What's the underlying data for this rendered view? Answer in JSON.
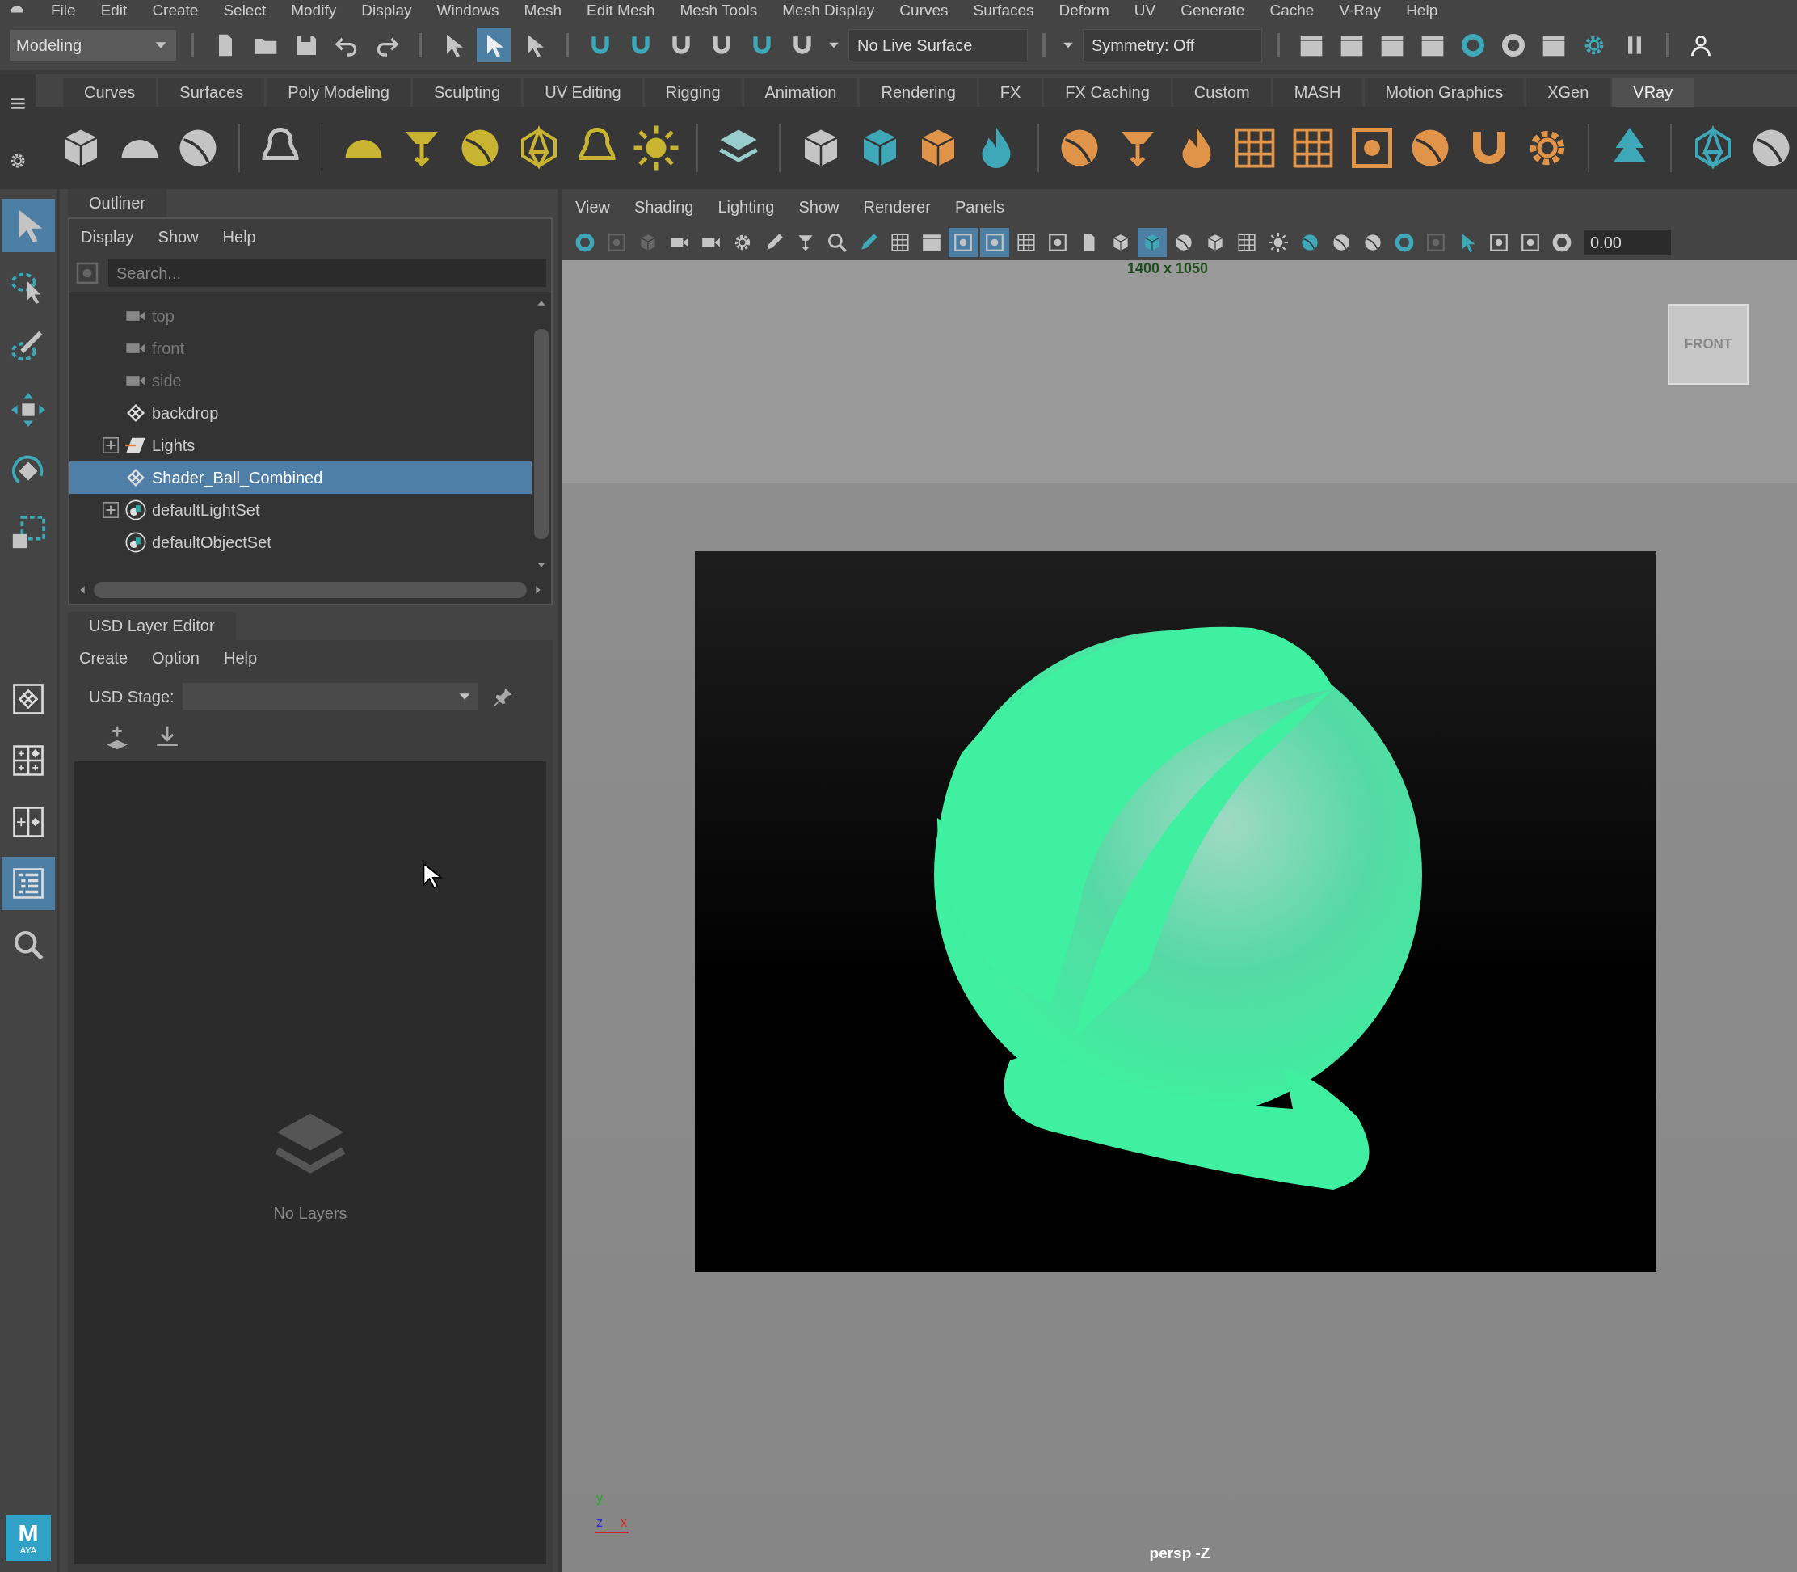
{
  "menu_bar": [
    "File",
    "Edit",
    "Create",
    "Select",
    "Modify",
    "Display",
    "Windows",
    "Mesh",
    "Edit Mesh",
    "Mesh Tools",
    "Mesh Display",
    "Curves",
    "Surfaces",
    "Deform",
    "UV",
    "Generate",
    "Cache",
    "V-Ray",
    "Help"
  ],
  "status_line": {
    "menu_set": "Modeling",
    "select_modes": [
      {
        "selected": false
      },
      {
        "selected": true
      },
      {
        "selected": false
      }
    ],
    "live_surface": "No Live Surface",
    "symmetry": "Symmetry: Off"
  },
  "shelf_tabs": [
    {
      "label": "Curves",
      "selected": false
    },
    {
      "label": "Surfaces",
      "selected": false
    },
    {
      "label": "Poly Modeling",
      "selected": false
    },
    {
      "label": "Sculpting",
      "selected": false
    },
    {
      "label": "UV Editing",
      "selected": false
    },
    {
      "label": "Rigging",
      "selected": false
    },
    {
      "label": "Animation",
      "selected": false
    },
    {
      "label": "Rendering",
      "selected": false
    },
    {
      "label": "FX",
      "selected": false
    },
    {
      "label": "FX Caching",
      "selected": false
    },
    {
      "label": "Custom",
      "selected": false
    },
    {
      "label": "MASH",
      "selected": false
    },
    {
      "label": "Motion Graphics",
      "selected": false
    },
    {
      "label": "XGen",
      "selected": false
    },
    {
      "label": "VRay",
      "selected": true
    }
  ],
  "toolbox": {
    "tools": [
      {
        "kind": "select",
        "selected": true
      },
      {
        "kind": "lasso",
        "selected": false
      },
      {
        "kind": "paint",
        "selected": false
      },
      {
        "kind": "move",
        "selected": false
      },
      {
        "kind": "rotate",
        "selected": false
      },
      {
        "kind": "scale",
        "selected": false
      }
    ],
    "layouts": [
      {
        "kind": "single",
        "selected": false
      },
      {
        "kind": "four",
        "selected": false
      },
      {
        "kind": "two",
        "selected": false
      },
      {
        "kind": "outliner",
        "selected": true
      }
    ],
    "logo": {
      "mark": "M",
      "sub": "AYA"
    }
  },
  "outliner": {
    "title": "Outliner",
    "menu": [
      "Display",
      "Show",
      "Help"
    ],
    "search": {
      "placeholder": "Search..."
    },
    "items": [
      {
        "label": "top",
        "kind": "camera",
        "hidden": true,
        "collapsible": false,
        "selected": false
      },
      {
        "label": "front",
        "kind": "camera",
        "hidden": true,
        "collapsible": false,
        "selected": false
      },
      {
        "label": "side",
        "kind": "camera",
        "hidden": true,
        "collapsible": false,
        "selected": false
      },
      {
        "label": "backdrop",
        "kind": "mesh",
        "hidden": false,
        "collapsible": false,
        "selected": false
      },
      {
        "label": "Lights",
        "kind": "group",
        "hidden": false,
        "collapsible": true,
        "selected": false
      },
      {
        "label": "Shader_Ball_Combined",
        "kind": "mesh",
        "hidden": false,
        "collapsible": false,
        "selected": true
      },
      {
        "label": "defaultLightSet",
        "kind": "set",
        "hidden": false,
        "collapsible": true,
        "selected": false
      },
      {
        "label": "defaultObjectSet",
        "kind": "set",
        "hidden": false,
        "collapsible": false,
        "selected": false
      }
    ]
  },
  "usd_layer_editor": {
    "title": "USD Layer Editor",
    "menu": [
      "Create",
      "Option",
      "Help"
    ],
    "stage_label": "USD Stage:",
    "empty_message": "No Layers"
  },
  "viewport": {
    "menu": [
      "View",
      "Shading",
      "Lighting",
      "Show",
      "Renderer",
      "Panels"
    ],
    "toolbar": [
      {
        "selected": false
      },
      {
        "selected": false
      },
      {
        "selected": false
      },
      {
        "selected": false
      },
      {
        "selected": false
      },
      {
        "selected": false
      },
      {
        "selected": false
      },
      {
        "selected": false
      },
      {
        "selected": false
      },
      {
        "selected": false
      },
      {
        "selected": false
      },
      {
        "selected": false
      },
      {
        "selected": true
      },
      {
        "selected": true
      },
      {
        "selected": false
      },
      {
        "selected": false
      },
      {
        "selected": false
      },
      {
        "selected": false
      },
      {
        "selected": true
      },
      {
        "selected": false
      },
      {
        "selected": false
      },
      {
        "selected": false
      },
      {
        "selected": false
      },
      {
        "selected": false
      },
      {
        "selected": false
      },
      {
        "selected": false
      },
      {
        "selected": false
      },
      {
        "selected": false
      },
      {
        "selected": false
      },
      {
        "selected": false
      },
      {
        "selected": false
      },
      {
        "selected": false
      }
    ],
    "exposure": "0.00",
    "resolution": "1400 x 1050",
    "view_cube": "FRONT",
    "axis": {
      "y": "y",
      "z": "z",
      "x": "x"
    },
    "camera_label": "persp -Z"
  }
}
